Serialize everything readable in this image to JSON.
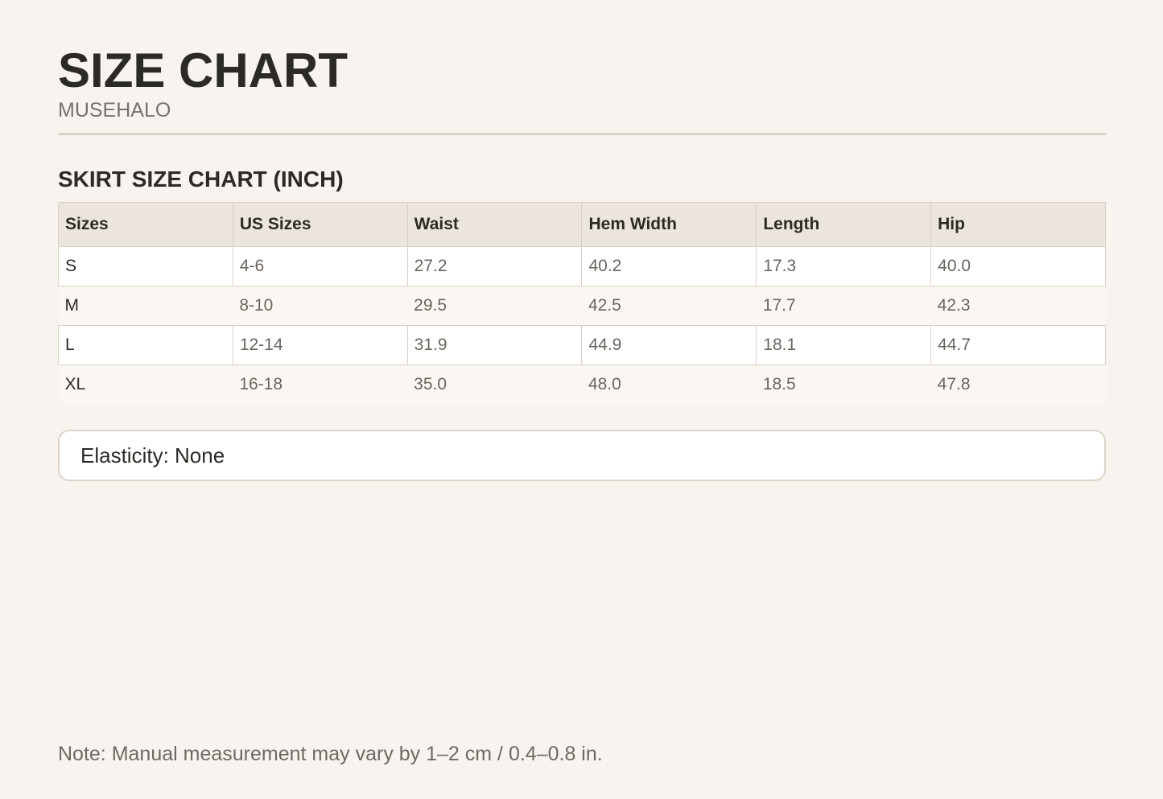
{
  "header": {
    "title": "SIZE CHART",
    "brand": "MUSEHALO"
  },
  "section": {
    "title": "SKIRT SIZE CHART (INCH)"
  },
  "table": {
    "columns": [
      "Sizes",
      "US Sizes",
      "Waist",
      "Hem Width",
      "Length",
      "Hip"
    ],
    "rows": [
      [
        "S",
        "4-6",
        "27.2",
        "40.2",
        "17.3",
        "40.0"
      ],
      [
        "M",
        "8-10",
        "29.5",
        "42.5",
        "17.7",
        "42.3"
      ],
      [
        "L",
        "12-14",
        "31.9",
        "44.9",
        "18.1",
        "44.7"
      ],
      [
        "XL",
        "16-18",
        "35.0",
        "48.0",
        "18.5",
        "47.8"
      ]
    ]
  },
  "elasticity": {
    "text": "Elasticity: None"
  },
  "footer": {
    "note": "Note: Manual measurement may vary by 1–2 cm / 0.4–0.8 in."
  },
  "colors": {
    "background": "#f7f4ef",
    "header_row": "#ece5dc",
    "border": "#ddd3c8",
    "text_primary": "#2c2a26",
    "text_secondary": "#6a645d"
  }
}
